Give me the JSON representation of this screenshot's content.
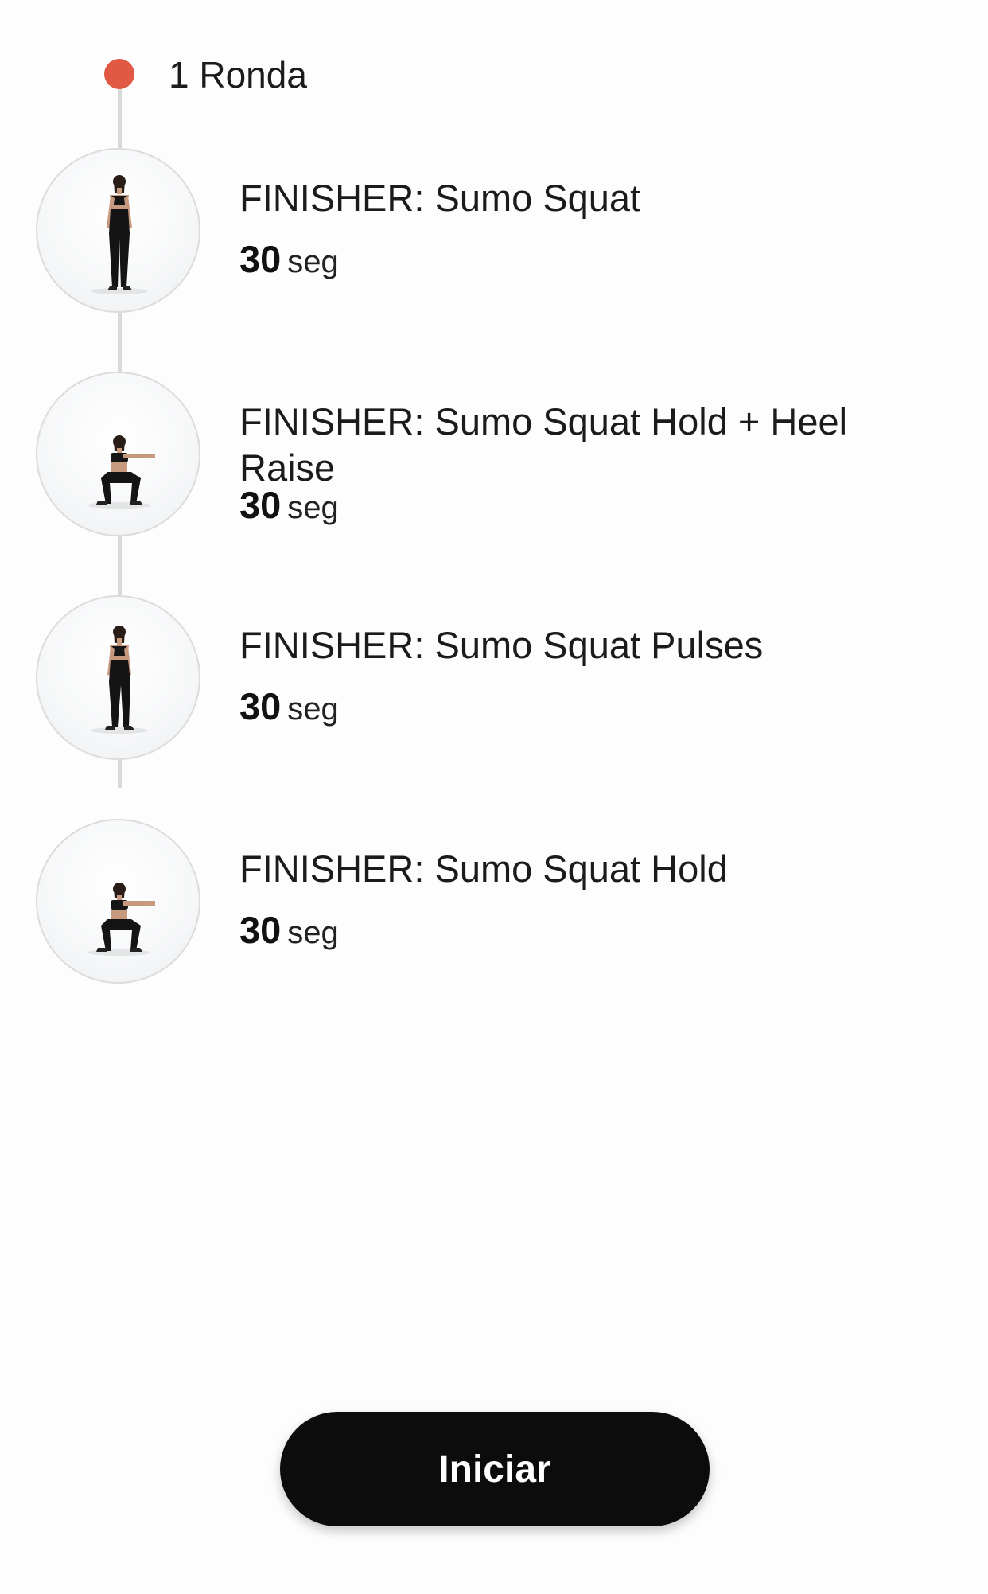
{
  "round": {
    "label": "1 Ronda",
    "accent_color": "#e15845"
  },
  "exercises": [
    {
      "title": "FINISHER: Sumo Squat",
      "duration_value": "30",
      "duration_unit": "seg",
      "pose": "standing"
    },
    {
      "title": "FINISHER: Sumo Squat Hold + Heel Raise",
      "duration_value": "30",
      "duration_unit": "seg",
      "pose": "squat"
    },
    {
      "title": "FINISHER: Sumo Squat Pulses",
      "duration_value": "30",
      "duration_unit": "seg",
      "pose": "standing"
    },
    {
      "title": "FINISHER: Sumo Squat Hold",
      "duration_value": "30",
      "duration_unit": "seg",
      "pose": "squat"
    }
  ],
  "footer": {
    "start_label": "Iniciar"
  }
}
